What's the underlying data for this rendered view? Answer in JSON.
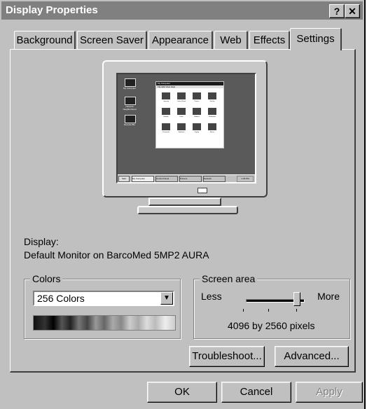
{
  "window": {
    "title": "Display Properties",
    "help_glyph": "?",
    "close_glyph": "✕"
  },
  "tabs": [
    "Background",
    "Screen Saver",
    "Appearance",
    "Web",
    "Effects",
    "Settings"
  ],
  "active_tab": "Settings",
  "display": {
    "label": "Display:",
    "value": "Default Monitor on BarcoMed 5MP2 AURA"
  },
  "colors": {
    "legend": "Colors",
    "selected": "256 Colors"
  },
  "screen_area": {
    "legend": "Screen area",
    "less": "Less",
    "more": "More",
    "value": "4096 by 2560 pixels",
    "slider_fraction": 1.0
  },
  "buttons": {
    "troubleshoot": "Troubleshoot...",
    "advanced": "Advanced...",
    "ok": "OK",
    "cancel": "Cancel",
    "apply": "Apply"
  },
  "preview": {
    "desktop_icons": [
      "My Computer",
      "Network Neighborhood",
      "Recycle Bin"
    ],
    "window_title": "My Computer",
    "window_menu": "File  Edit  View  Help",
    "window_items": [
      "Capacity",
      "Control Panel",
      "Printers",
      "Dial-Up",
      "Network",
      "Fonts",
      "Modems",
      "Multimedia",
      "Passwords",
      "Keyboard",
      "Display",
      "Mouse"
    ],
    "taskbar_start": "Start",
    "taskbar_items": [
      "My Computer",
      "Control Panel",
      "Printers",
      "Network"
    ],
    "taskbar_time": "1:45 PM"
  }
}
